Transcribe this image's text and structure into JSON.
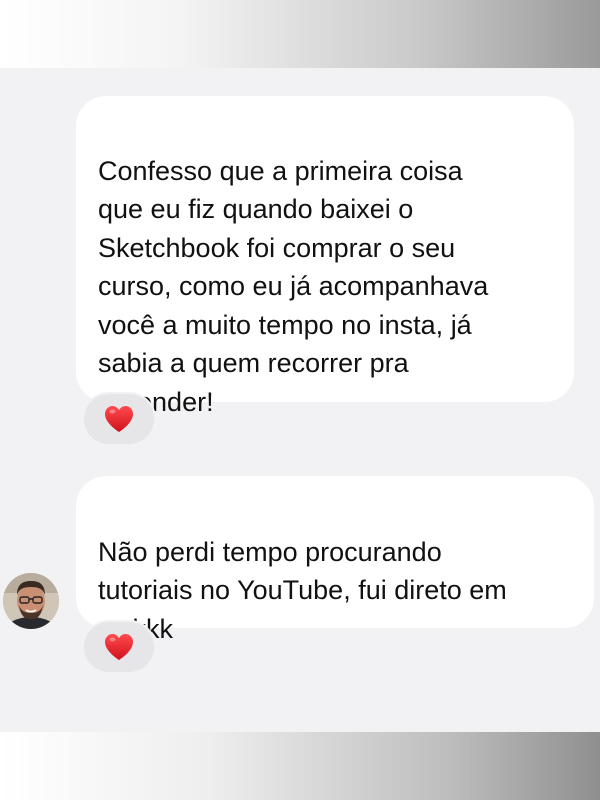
{
  "chat": {
    "messages": [
      {
        "text": "Confesso que a primeira coisa\nque eu fiz quando baixei o\nSketchbook foi comprar o seu\ncurso, como eu já acompanhava\nvocê a muito tempo no insta, já\nsabia a quem recorrer pra\naprender!",
        "reaction": "heart-icon"
      },
      {
        "text": "Não perdi tempo procurando\ntutoriais no YouTube, fui direto em\nvc kkk",
        "reaction": "heart-icon"
      }
    ],
    "colors": {
      "background": "#f2f2f4",
      "bubble": "#ffffff",
      "reaction_pill": "#e6e6e8",
      "heart": "#e0202a"
    }
  }
}
